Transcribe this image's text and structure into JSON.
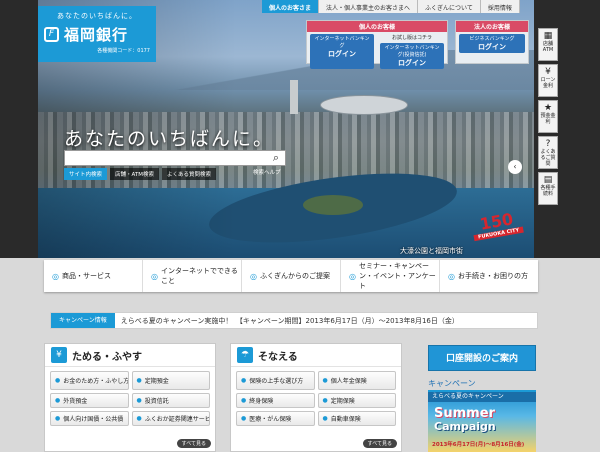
{
  "logo": {
    "tagline": "あなたのいちばんに。",
    "name": "福岡銀行",
    "code": "各種機関コード：0177"
  },
  "top_nav": [
    "個人のお客さま",
    "法人・個人事業主のお客さまへ",
    "ふくぎんについて",
    "採用情報"
  ],
  "login_personal": {
    "header": "個人のお客様",
    "net_banking": "インターネットバンキング",
    "login": "ログイン",
    "trial": "お試し版はコチラ",
    "inv_banking": "インターネットバンキング(投資信託)"
  },
  "login_corp": {
    "header": "法人のお客様",
    "business": "ビジネスバンキング",
    "login": "ログイン"
  },
  "side_tabs": [
    {
      "icon": "building-icon",
      "glyph": "▦",
      "label": "店舗ATM"
    },
    {
      "icon": "loan-icon",
      "glyph": "¥",
      "label": "ローン金利"
    },
    {
      "icon": "star-icon",
      "glyph": "★",
      "label": "預金金利"
    },
    {
      "icon": "question-icon",
      "glyph": "?",
      "label": "よくあるご質問"
    },
    {
      "icon": "document-icon",
      "glyph": "▤",
      "label": "各種手続料"
    }
  ],
  "hero": {
    "catch": "あなたのいちばんに。",
    "search_tabs": [
      "サイト内検索",
      "店舗・ATM検索",
      "よくある質問検索"
    ],
    "help": "検索ヘルプ",
    "caption": "大濠公園と福岡市街",
    "anniv_number": "150",
    "anniv_label": "FUKUOKA CITY"
  },
  "main_nav": [
    "商品・サービス",
    "インターネットでできること",
    "ふくぎんからのご提案",
    "セミナー・キャンペーン・イベント・アンケート",
    "お手続き・お困りの方"
  ],
  "campaign": {
    "label": "キャンペーン情報",
    "text": "えらべる夏のキャンペーン実施中！　【キャンペーン期間】2013年6月17日（月）～2013年8月16日（金）"
  },
  "panel_save": {
    "title": "ためる・ふやす",
    "items": [
      "お金のため方・ふやし方",
      "定期預金",
      "外貨預金",
      "投資信託",
      "個人向け国債・公共債",
      "ふくおか証券関連サービス"
    ],
    "more": "すべて見る"
  },
  "panel_prepare": {
    "title": "そなえる",
    "items": [
      "保険の上手な選び方",
      "個人年金保険",
      "終身保険",
      "定期保険",
      "医療・がん保険",
      "自動車保険"
    ],
    "more": "すべて見る"
  },
  "account_button": "口座開設のご案内",
  "side_campaign": {
    "header": "キャンペーン",
    "banner_top": "えらべる夏のキャンペーン",
    "summer": "Summer",
    "campaign": "Campaign",
    "dates": "2013年6月17日(月)～8月16日(金)"
  }
}
